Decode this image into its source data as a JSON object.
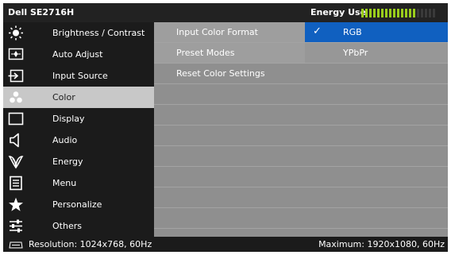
{
  "header": {
    "title": "Dell SE2716H",
    "energy_label": "Energy Use",
    "energy_level": 0.74,
    "energy_color": "#9acd1c"
  },
  "menu": {
    "items": [
      {
        "label": "Brightness / Contrast",
        "icon": "brightness-icon"
      },
      {
        "label": "Auto Adjust",
        "icon": "auto-adjust-icon"
      },
      {
        "label": "Input Source",
        "icon": "input-source-icon"
      },
      {
        "label": "Color",
        "icon": "color-icon",
        "active": true
      },
      {
        "label": "Display",
        "icon": "display-icon"
      },
      {
        "label": "Audio",
        "icon": "speaker-icon"
      },
      {
        "label": "Energy",
        "icon": "leaf-icon"
      },
      {
        "label": "Menu",
        "icon": "menu-icon"
      },
      {
        "label": "Personalize",
        "icon": "star-icon"
      },
      {
        "label": "Others",
        "icon": "sliders-icon"
      }
    ]
  },
  "color_submenu": {
    "items": [
      {
        "label": "Input Color Format"
      },
      {
        "label": "Preset Modes"
      },
      {
        "label": "Reset Color Settings"
      }
    ],
    "input_color_format_options": [
      {
        "label": "RGB",
        "selected": true
      },
      {
        "label": "YPbPr",
        "selected": false
      }
    ],
    "selected_color": "#1060c0"
  },
  "footer": {
    "resolution": "Resolution: 1024x768, 60Hz",
    "maximum": "Maximum: 1920x1080, 60Hz"
  }
}
